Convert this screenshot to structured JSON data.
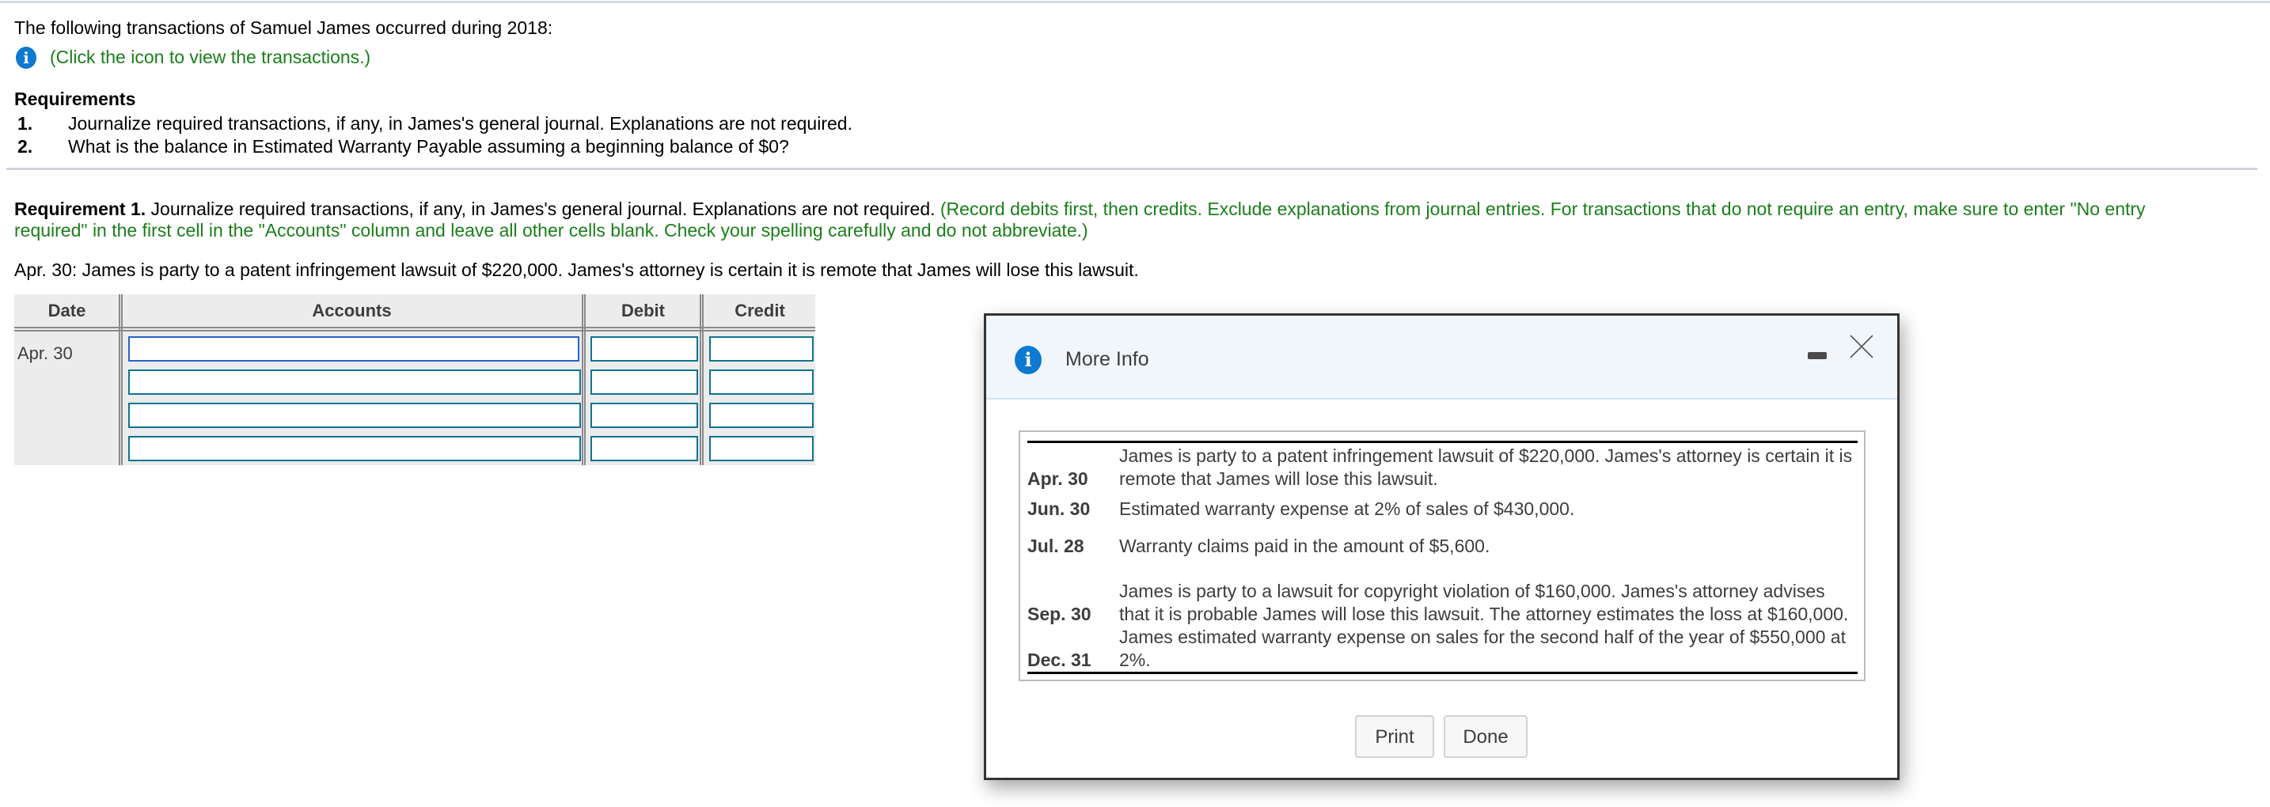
{
  "intro": {
    "text": "The following transactions of Samuel James occurred during 2018:",
    "info_link": "(Click the icon to view the transactions.)"
  },
  "requirements": {
    "heading": "Requirements",
    "items": [
      {
        "num": "1.",
        "text": "Journalize required transactions, if any, in James's general journal. Explanations are not required."
      },
      {
        "num": "2.",
        "text": "What is the balance in Estimated Warranty Payable assuming a beginning balance of $0?"
      }
    ]
  },
  "requirement1": {
    "label": "Requirement 1.",
    "text": " Journalize required transactions, if any, in James's general journal. Explanations are not required. ",
    "instruction_line1": "(Record debits first, then credits. Exclude explanations from journal entries. For transactions that do not require an entry, make sure to enter \"No entry",
    "instruction_line2": "required\" in the first cell in the \"Accounts\" column and leave all other cells blank. Check your spelling carefully and do not abbreviate.)",
    "prompt": "Apr. 30: James is party to a patent infringement lawsuit of $220,000. James's attorney is certain it is remote that James will lose this lawsuit."
  },
  "journal": {
    "headers": {
      "date": "Date",
      "accounts": "Accounts",
      "debit": "Debit",
      "credit": "Credit"
    },
    "date": "Apr. 30",
    "rows": [
      {
        "account": "",
        "debit": "",
        "credit": ""
      },
      {
        "account": "",
        "debit": "",
        "credit": ""
      },
      {
        "account": "",
        "debit": "",
        "credit": ""
      },
      {
        "account": "",
        "debit": "",
        "credit": ""
      }
    ]
  },
  "modal": {
    "title": "More Info",
    "icons": {
      "info": "info-icon",
      "minimize": "minimize-icon",
      "close": "close-icon"
    },
    "transactions": [
      {
        "date": "Apr. 30",
        "text": "James is party to a patent infringement lawsuit of $220,000. James's attorney is certain it is remote that James will lose this lawsuit."
      },
      {
        "date": "Jun. 30",
        "text": "Estimated warranty expense at 2% of sales of $430,000."
      },
      {
        "date": "Jul. 28",
        "text": "Warranty claims paid in the amount of $5,600."
      },
      {
        "date": "Sep. 30",
        "text": "James is party to a lawsuit for copyright violation of $160,000. James's attorney advises that it is probable James will lose this lawsuit. The attorney estimates the loss at $160,000."
      },
      {
        "date": "Dec. 31",
        "text": "James estimated warranty expense on sales for the second half of the year of $550,000 at 2%."
      }
    ],
    "buttons": {
      "print": "Print",
      "done": "Done"
    }
  }
}
